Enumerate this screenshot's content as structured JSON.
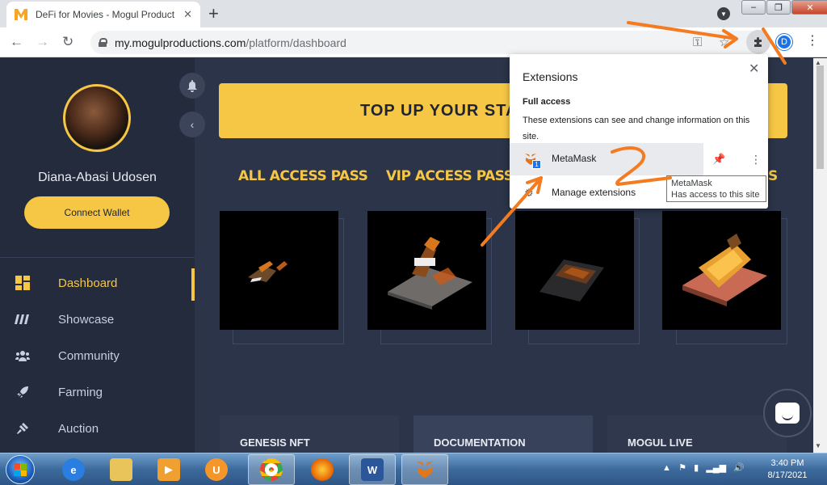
{
  "browser": {
    "tab_title": "DeFi for Movies - Mogul Product",
    "url_host": "my.mogulproductions.com",
    "url_path": "/platform/dashboard",
    "profile_initial": "D"
  },
  "sidebar": {
    "username": "Diana-Abasi Udosen",
    "connect_wallet": "Connect Wallet",
    "items": [
      {
        "label": "Dashboard",
        "icon": "dashboard-icon",
        "active": true
      },
      {
        "label": "Showcase",
        "icon": "showcase-icon"
      },
      {
        "label": "Community",
        "icon": "community-icon"
      },
      {
        "label": "Farming",
        "icon": "rocket-icon"
      },
      {
        "label": "Auction",
        "icon": "gavel-icon"
      }
    ]
  },
  "main": {
    "banner": "TOP UP YOUR STAR",
    "passes": [
      {
        "title": "ALL ACCESS PASS"
      },
      {
        "title": "VIP ACCESS PASS"
      },
      {
        "title": ""
      },
      {
        "title": "S"
      }
    ],
    "bottom_cards": [
      "GENESIS NFT",
      "DOCUMENTATION",
      "MOGUL LIVE"
    ]
  },
  "extensions_popup": {
    "title": "Extensions",
    "section": "Full access",
    "description": "These extensions can see and change information on this site.",
    "extension_name": "MetaMask",
    "badge": "1",
    "manage": "Manage extensions"
  },
  "tooltip": {
    "line1": "MetaMask",
    "line2": "Has access to this site"
  },
  "annotation": {
    "number": "2",
    "color": "#f47b20"
  },
  "taskbar": {
    "time": "3:40 PM",
    "date": "8/17/2021"
  },
  "colors": {
    "accent": "#f6c645",
    "sidebar": "#232b3c",
    "page": "#2b3448"
  }
}
